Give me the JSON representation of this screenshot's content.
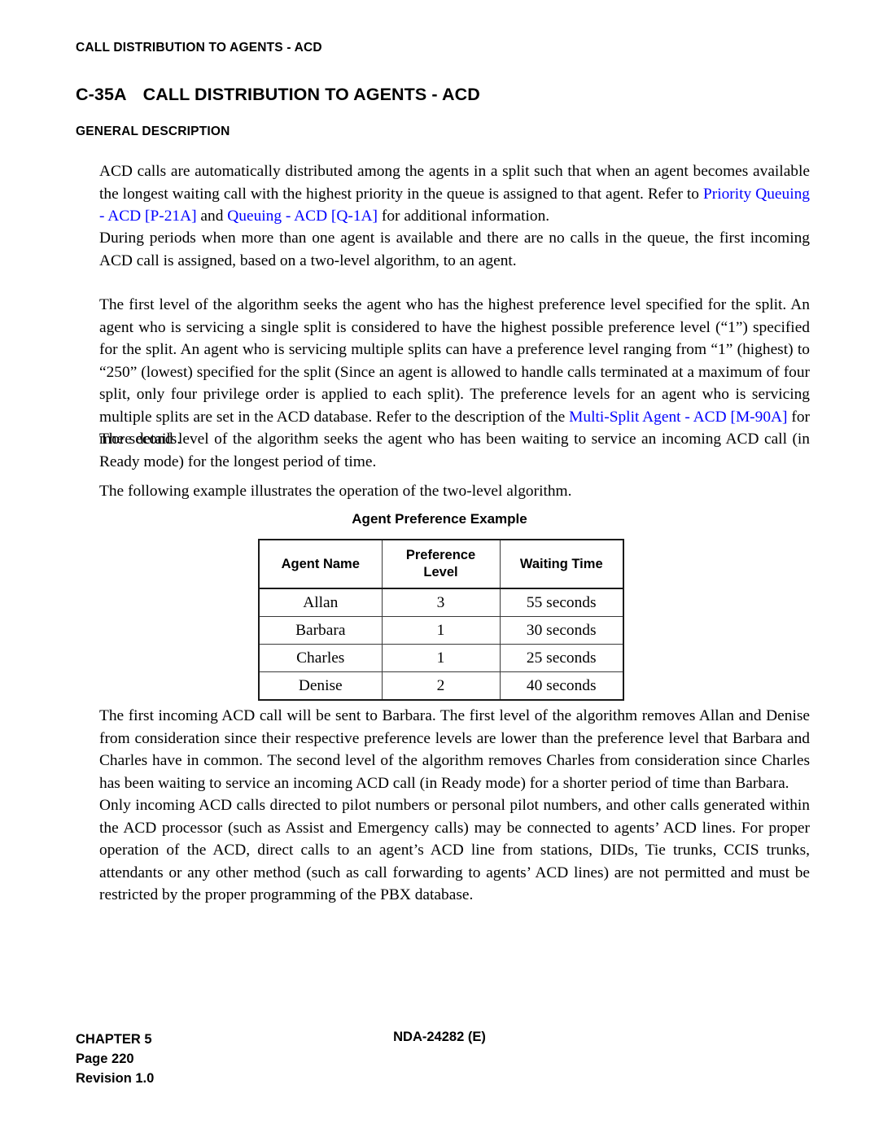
{
  "running_head": "CALL DISTRIBUTION TO AGENTS - ACD",
  "heading": {
    "number": "C-35A",
    "title": "CALL DISTRIBUTION TO AGENTS - ACD",
    "subheading": "GENERAL DESCRIPTION"
  },
  "paragraphs": {
    "p1_a": "ACD calls are automatically distributed among the agents in a split such that when an agent becomes available the longest waiting call with the highest priority in the queue is assigned to that agent. Refer to ",
    "p1_link1": "Priority Queuing - ACD [P-21A]",
    "p1_b": " and ",
    "p1_link2": "Queuing - ACD [Q-1A]",
    "p1_c": " for additional information.",
    "p2": "During periods when more than one agent is available and there are no calls in the queue, the first incoming ACD call is assigned, based on a two-level algorithm, to an agent.",
    "p3_a": "The first level of the algorithm seeks the agent who has the highest preference level specified for the split. An agent who is servicing a single split is considered to have the highest possible preference level (“1”) specified for the split. An agent who is servicing multiple splits can have a preference level ranging from “1” (highest) to “250” (lowest) specified for the split (Since an agent is allowed to handle calls terminated at a maximum of four split, only four privilege order is applied to each split). The preference levels for an agent who is servicing multiple splits are set in the ACD database. Refer to the description of the ",
    "p3_link": "Multi-Split Agent - ACD  [M-90A]",
    "p3_b": " for more details.",
    "p4": "The second level of the algorithm seeks the agent who has been waiting to service an incoming ACD call (in Ready mode) for the longest period of time.",
    "p5": "The following example illustrates the operation of the two-level algorithm.",
    "p6": "The first incoming ACD call will be sent to Barbara. The first level of the algorithm removes Allan and Denise from consideration since their respective preference levels are lower than the preference level that Barbara and Charles have in common. The second level of the algorithm removes Charles from consideration since Charles has been waiting to service an incoming ACD call (in Ready mode) for a shorter period of time than Barbara.",
    "p7": "Only incoming ACD calls directed to pilot numbers or personal pilot numbers, and other calls generated within the ACD processor (such as Assist and Emergency calls) may be connected to agents’ ACD lines. For proper operation of the ACD, direct calls to an agent’s ACD line from stations, DIDs, Tie trunks, CCIS trunks, attendants or any other method (such as call forwarding to agents’ ACD lines) are not permitted and must be restricted by the proper programming of the PBX database."
  },
  "table": {
    "caption": "Agent Preference Example",
    "columns": [
      "Agent Name",
      "Preference Level",
      "Waiting Time"
    ],
    "column_header_lines": [
      [
        "Agent Name"
      ],
      [
        "Preference",
        "Level"
      ],
      [
        "Waiting Time"
      ]
    ],
    "rows": [
      {
        "agent_name": "Allan",
        "preference_level": "3",
        "waiting_time": "55 seconds"
      },
      {
        "agent_name": "Barbara",
        "preference_level": "1",
        "waiting_time": "30 seconds"
      },
      {
        "agent_name": "Charles",
        "preference_level": "1",
        "waiting_time": "25 seconds"
      },
      {
        "agent_name": "Denise",
        "preference_level": "2",
        "waiting_time": "40 seconds"
      }
    ]
  },
  "footer": {
    "chapter": "CHAPTER 5",
    "page": "Page 220",
    "revision": "Revision 1.0",
    "document_number": "NDA-24282 (E)"
  },
  "colors": {
    "link": "#0000ff",
    "text": "#000000",
    "table_border": "#1a1a1a"
  }
}
